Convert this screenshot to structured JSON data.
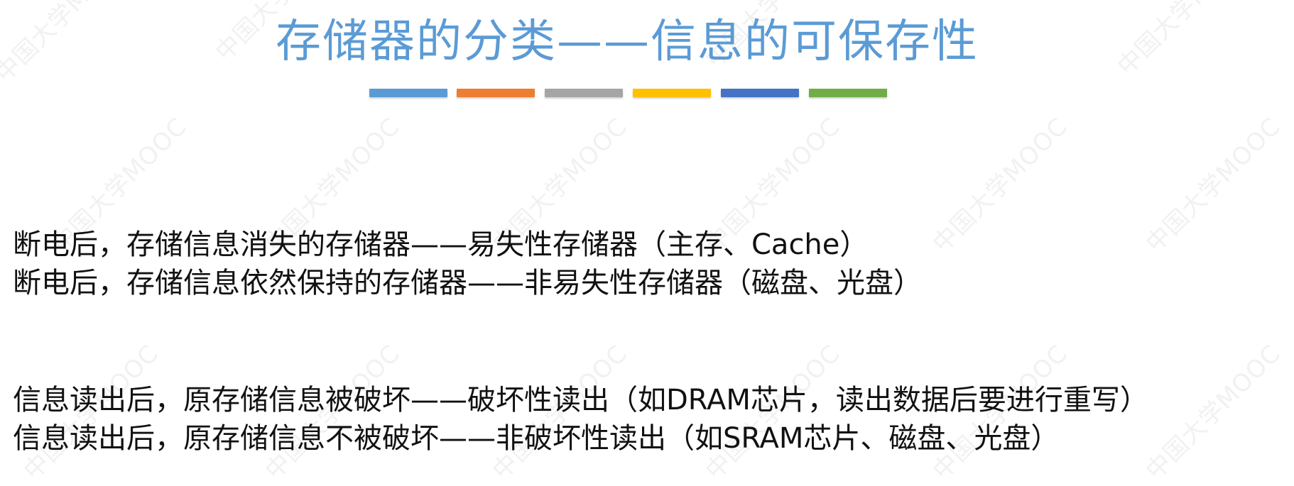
{
  "slide": {
    "title": "存储器的分类——信息的可保存性",
    "watermark_text": "中国大学MOOC",
    "accent_bars": [
      {
        "color": "#5b9bd5"
      },
      {
        "color": "#ed7d31"
      },
      {
        "color": "#a5a5a5"
      },
      {
        "color": "#ffc000"
      },
      {
        "color": "#4472c4"
      },
      {
        "color": "#70ad47"
      }
    ],
    "lines": [
      "断电后，存储信息消失的存储器——易失性存储器（主存、Cache）",
      "断电后，存储信息依然保持的存储器——非易失性存储器（磁盘、光盘）",
      "信息读出后，原存储信息被破坏——破坏性读出（如DRAM芯片，读出数据后要进行重写）",
      "信息读出后，原存储信息不被破坏——非破坏性读出（如SRAM芯片、磁盘、光盘）"
    ]
  }
}
